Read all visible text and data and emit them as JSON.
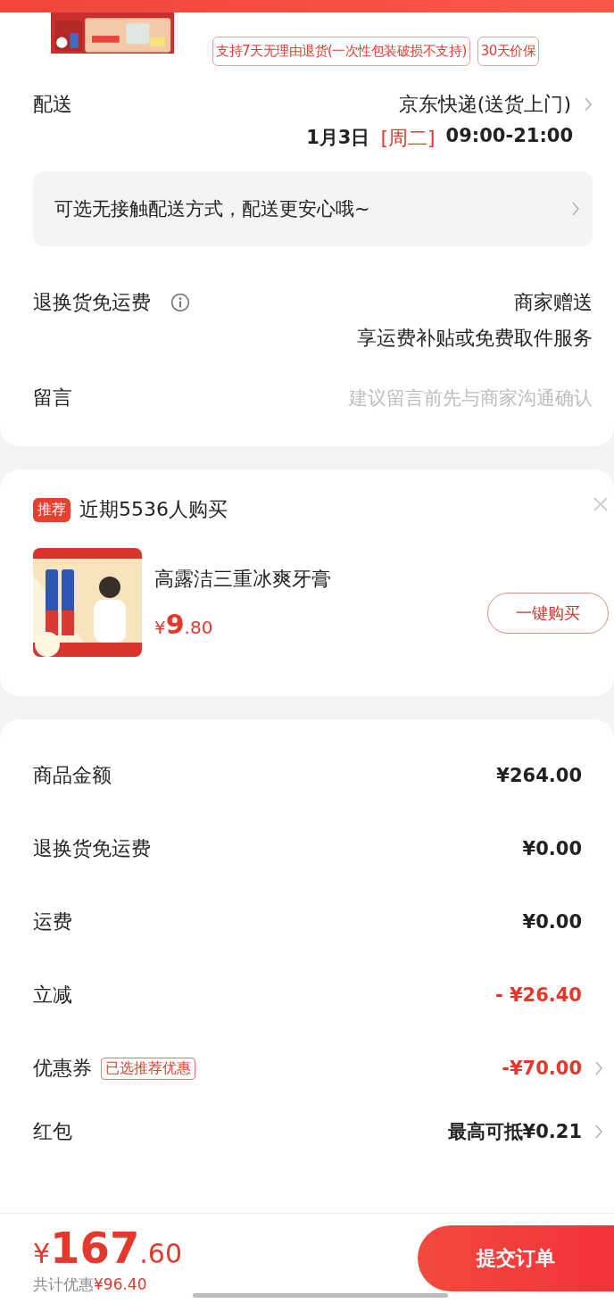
{
  "top_product": {
    "tags": [
      "支持7天无理由退货(一次性包装破损不支持)",
      "30天价保"
    ]
  },
  "delivery": {
    "label": "配送",
    "method": "京东快递(送货上门)",
    "date": "1月3日",
    "weekday": "[周二]",
    "time_slot": "09:00-21:00"
  },
  "contactless_notice": "可选无接触配送方式，配送更安心哦~",
  "return_shipping": {
    "label": "退换货免运费",
    "value": "商家赠送",
    "detail": "享运费补贴或免费取件服务"
  },
  "message": {
    "label": "留言",
    "placeholder": "建议留言前先与商家沟通确认"
  },
  "recommendation": {
    "badge": "推荐",
    "title": "近期5536人购买",
    "product": {
      "name": "高露洁三重冰爽牙膏",
      "currency": "¥",
      "price_integer": "9",
      "price_decimal": ".80"
    },
    "buy_button": "一键购买"
  },
  "summary": {
    "rows": [
      {
        "kind": "amount",
        "label": "商品金额",
        "value": "¥264.00"
      },
      {
        "kind": "amount",
        "label": "退换货免运费",
        "value": "¥0.00"
      },
      {
        "kind": "amount",
        "label": "运费",
        "value": "¥0.00"
      },
      {
        "kind": "discount",
        "label": "立减",
        "value": "- ¥26.40"
      },
      {
        "kind": "coupon",
        "label": "优惠券",
        "tag": "已选推荐优惠",
        "value": "-¥70.00"
      },
      {
        "kind": "link",
        "label": "红包",
        "value": "最高可抵¥0.21"
      }
    ]
  },
  "bottom_bar": {
    "currency": "¥",
    "total_integer": "167",
    "total_decimal": ".60",
    "savings_label": "共计优惠",
    "savings_value": "¥96.40",
    "submit_button": "提交订单"
  }
}
